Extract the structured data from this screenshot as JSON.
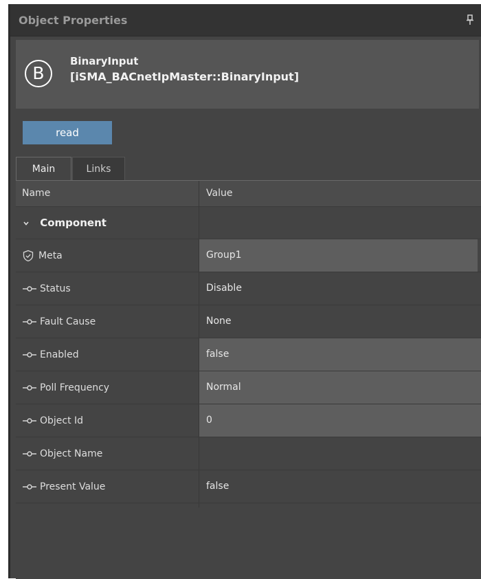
{
  "panel": {
    "title": "Object Properties",
    "pin_icon": "pin-icon"
  },
  "object": {
    "icon_letter": "B",
    "name": "BinaryInput",
    "type": "[iSMA_BACnetIpMaster::BinaryInput]"
  },
  "actions": {
    "read_label": "read"
  },
  "tabs": [
    {
      "label": "Main",
      "active": true
    },
    {
      "label": "Links",
      "active": false
    }
  ],
  "grid": {
    "columns": {
      "name": "Name",
      "value": "Value"
    },
    "group": {
      "label": "Component",
      "expanded": true
    },
    "rows": [
      {
        "name": "Meta",
        "value": "Group1",
        "icon": "shield-icon",
        "editable": true
      },
      {
        "name": "Status",
        "value": "Disable",
        "icon": "slot-icon",
        "editable": false
      },
      {
        "name": "Fault Cause",
        "value": "None",
        "icon": "slot-icon",
        "editable": false
      },
      {
        "name": "Enabled",
        "value": "false",
        "icon": "slot-icon",
        "editable": true
      },
      {
        "name": "Poll Frequency",
        "value": "Normal",
        "icon": "slot-icon",
        "editable": true
      },
      {
        "name": "Object Id",
        "value": "0",
        "icon": "slot-icon",
        "editable": true
      },
      {
        "name": "Object Name",
        "value": "",
        "icon": "slot-icon",
        "editable": false
      },
      {
        "name": "Present Value",
        "value": "false",
        "icon": "slot-icon",
        "editable": false
      }
    ]
  },
  "colors": {
    "panel_bg": "#444444",
    "header_bg": "#333333",
    "button_accent": "#5b87ad",
    "editable_cell": "#5e5e5e"
  }
}
